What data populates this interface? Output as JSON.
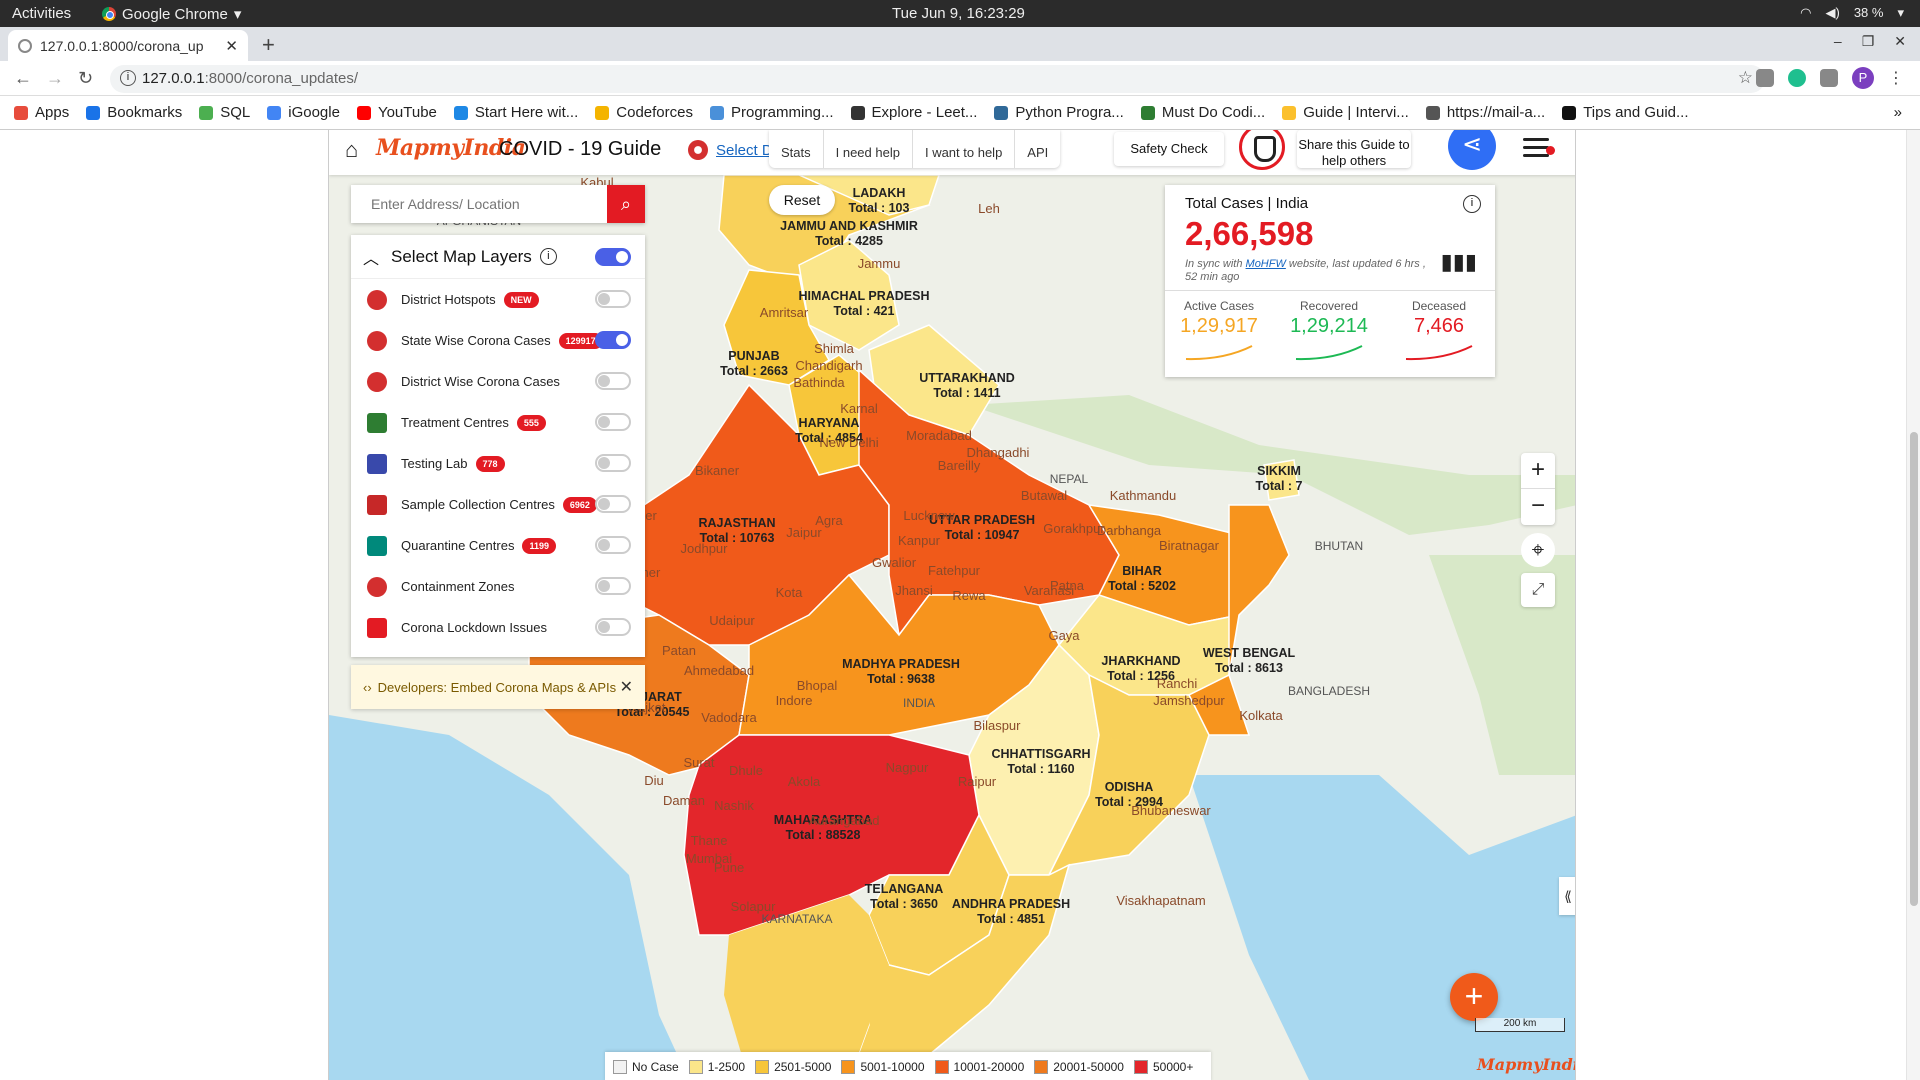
{
  "os": {
    "activities": "Activities",
    "app": "Google Chrome",
    "clock": "Tue Jun  9, 16:23:29",
    "battery": "38 %"
  },
  "browser": {
    "tab_title": "127.0.0.1:8000/corona_up",
    "url_host": "127.0.0.1",
    "url_rest": ":8000/corona_updates/",
    "bookmarks": [
      "Apps",
      "Bookmarks",
      "SQL",
      "iGoogle",
      "YouTube",
      "Start Here wit...",
      "Codeforces",
      "Programming...",
      "Explore - Leet...",
      "Python Progra...",
      "Must Do Codi...",
      "Guide | Intervi...",
      "https://mail-a...",
      "Tips and Guid..."
    ],
    "avatar": "P"
  },
  "header": {
    "logo": "MapmyIndia",
    "title": "COVID - 19 Guide",
    "select_district": "Select Distr",
    "buttons": [
      "Stats",
      "I need help",
      "I want to help",
      "API"
    ],
    "safety_check": "Safety Check",
    "share_text": "Share this Guide to help others"
  },
  "search": {
    "placeholder": "Enter Address/ Location"
  },
  "layers": {
    "title": "Select Map Layers",
    "items": [
      {
        "label": "District Hotspots",
        "badge": "NEW",
        "icon": "virus-icon",
        "color": "#d32f2f",
        "on": false
      },
      {
        "label": "State Wise Corona Cases",
        "badge": "129917",
        "icon": "virus-icon",
        "color": "#d32f2f",
        "on": true
      },
      {
        "label": "District Wise Corona Cases",
        "badge": "",
        "icon": "virus-icon",
        "color": "#d32f2f",
        "on": false
      },
      {
        "label": "Treatment Centres",
        "badge": "555",
        "icon": "hospital-icon",
        "color": "#2e7d32",
        "on": false
      },
      {
        "label": "Testing Lab",
        "badge": "778",
        "icon": "flask-icon",
        "color": "#3949ab",
        "on": false
      },
      {
        "label": "Sample Collection Centres",
        "badge": "6962",
        "icon": "collection-icon",
        "color": "#c62828",
        "on": false
      },
      {
        "label": "Quarantine Centres",
        "badge": "1199",
        "icon": "bed-icon",
        "color": "#00897b",
        "on": false
      },
      {
        "label": "Containment Zones",
        "badge": "",
        "icon": "virus-icon",
        "color": "#d32f2f",
        "on": false
      },
      {
        "label": "Corona Lockdown Issues",
        "badge": "",
        "icon": "lock-icon",
        "color": "#e31b23",
        "on": false
      }
    ]
  },
  "developers": {
    "text": "Developers: Embed Corona Maps & APIs"
  },
  "reset": "Reset",
  "stats": {
    "title": "Total Cases | India",
    "total": "2,66,598",
    "sync_prefix": "In sync with",
    "sync_link": "MoHFW",
    "sync_suffix": "website, last updated 6 hrs , 52 min ago",
    "active_label": "Active Cases",
    "active": "1,29,917",
    "active_color": "#f5a623",
    "recovered_label": "Recovered",
    "recovered": "1,29,214",
    "recovered_color": "#1db954",
    "deceased_label": "Deceased",
    "deceased": "7,466",
    "deceased_color": "#e31b23"
  },
  "map": {
    "states": [
      {
        "name": "JAMMU AND KASHMIR",
        "total": "Total : 4285",
        "color": "#f8d15a"
      },
      {
        "name": "HIMACHAL PRADESH",
        "total": "Total : 421",
        "color": "#fbe68a"
      },
      {
        "name": "PUNJAB",
        "total": "Total : 2663",
        "color": "#f7c63a"
      },
      {
        "name": "UTTARAKHAND",
        "total": "Total : 1411",
        "color": "#fbe68a"
      },
      {
        "name": "HARYANA",
        "total": "Total : 4854",
        "color": "#f7c63a"
      },
      {
        "name": "RAJASTHAN",
        "total": "Total : 10763",
        "color": "#f05a1a"
      },
      {
        "name": "UTTAR PRADESH",
        "total": "Total : 10947",
        "color": "#f05a1a"
      },
      {
        "name": "BIHAR",
        "total": "Total : 5202",
        "color": "#f7941d"
      },
      {
        "name": "SIKKIM",
        "total": "Total : 7",
        "color": "#fbe68a"
      },
      {
        "name": "GUJARAT",
        "total": "Total : 20545",
        "color": "#ee7a1e"
      },
      {
        "name": "MADHYA PRADESH",
        "total": "Total : 9638",
        "color": "#f7941d"
      },
      {
        "name": "JHARKHAND",
        "total": "Total : 1256",
        "color": "#fbe68a"
      },
      {
        "name": "WEST BENGAL",
        "total": "Total : 8613",
        "color": "#f7941d"
      },
      {
        "name": "CHHATTISGARH",
        "total": "Total : 1160",
        "color": "#fdf0b0"
      },
      {
        "name": "ODISHA",
        "total": "Total : 2994",
        "color": "#f8d15a"
      },
      {
        "name": "MAHARASHTRA",
        "total": "Total : 88528",
        "color": "#e3262b"
      },
      {
        "name": "TELANGANA",
        "total": "Total : 3650",
        "color": "#f8d15a"
      },
      {
        "name": "ANDHRA PRADESH",
        "total": "Total : 4851",
        "color": "#f8d15a"
      },
      {
        "name": "LADAKH",
        "total": "Total : 103",
        "color": "#fbe68a"
      }
    ],
    "places": [
      "Kabul",
      "AFGHANISTAN",
      "Leh",
      "Jammu",
      "Amritsar",
      "Shimla",
      "Chandigarh",
      "Bathinda",
      "Karnal",
      "New Delhi",
      "Moradabad",
      "Bareilly",
      "Bikaner",
      "Jaisalmer",
      "Jodhpur",
      "Jaipur",
      "Agra",
      "Lucknow",
      "Kanpur",
      "Fatehpur",
      "Gorakhpur",
      "Varanasi",
      "Patna",
      "Gaya",
      "Darbhanga",
      "Barmer",
      "Kota",
      "Gwalior",
      "Jhansi",
      "Rewa",
      "Udaipur",
      "Patan",
      "Ahmedabad",
      "Rajkot",
      "Vadodara",
      "Indore",
      "Bhopal",
      "INDIA",
      "Ranchi",
      "Jamshedpur",
      "Kolkata",
      "Surat",
      "Diu",
      "Daman",
      "Dhule",
      "Akola",
      "Nagpur",
      "Raipur",
      "Bilaspur",
      "Nashik",
      "Thane",
      "Mumbai",
      "Pune",
      "Solapur",
      "Aurangabad",
      "Bhubaneswar",
      "Visakhapatnam",
      "NEPAL",
      "Butawal",
      "Kathmandu",
      "Dhangadhi",
      "Biratnagar",
      "BANGLADESH",
      "BHUTAN",
      "KARNATAKA"
    ]
  },
  "controls": {
    "zoom_in": "+",
    "zoom_out": "−",
    "scale": "200 km",
    "watermark": "MapmyIndia"
  },
  "legend": [
    {
      "label": "No Case",
      "color": "#f2f2f2"
    },
    {
      "label": "1-2500",
      "color": "#fbe68a"
    },
    {
      "label": "2501-5000",
      "color": "#f7c63a"
    },
    {
      "label": "5001-10000",
      "color": "#f7941d"
    },
    {
      "label": "10001-20000",
      "color": "#f05a1a"
    },
    {
      "label": "20001-50000",
      "color": "#ee7a1e"
    },
    {
      "label": "50000+",
      "color": "#e3262b"
    }
  ]
}
